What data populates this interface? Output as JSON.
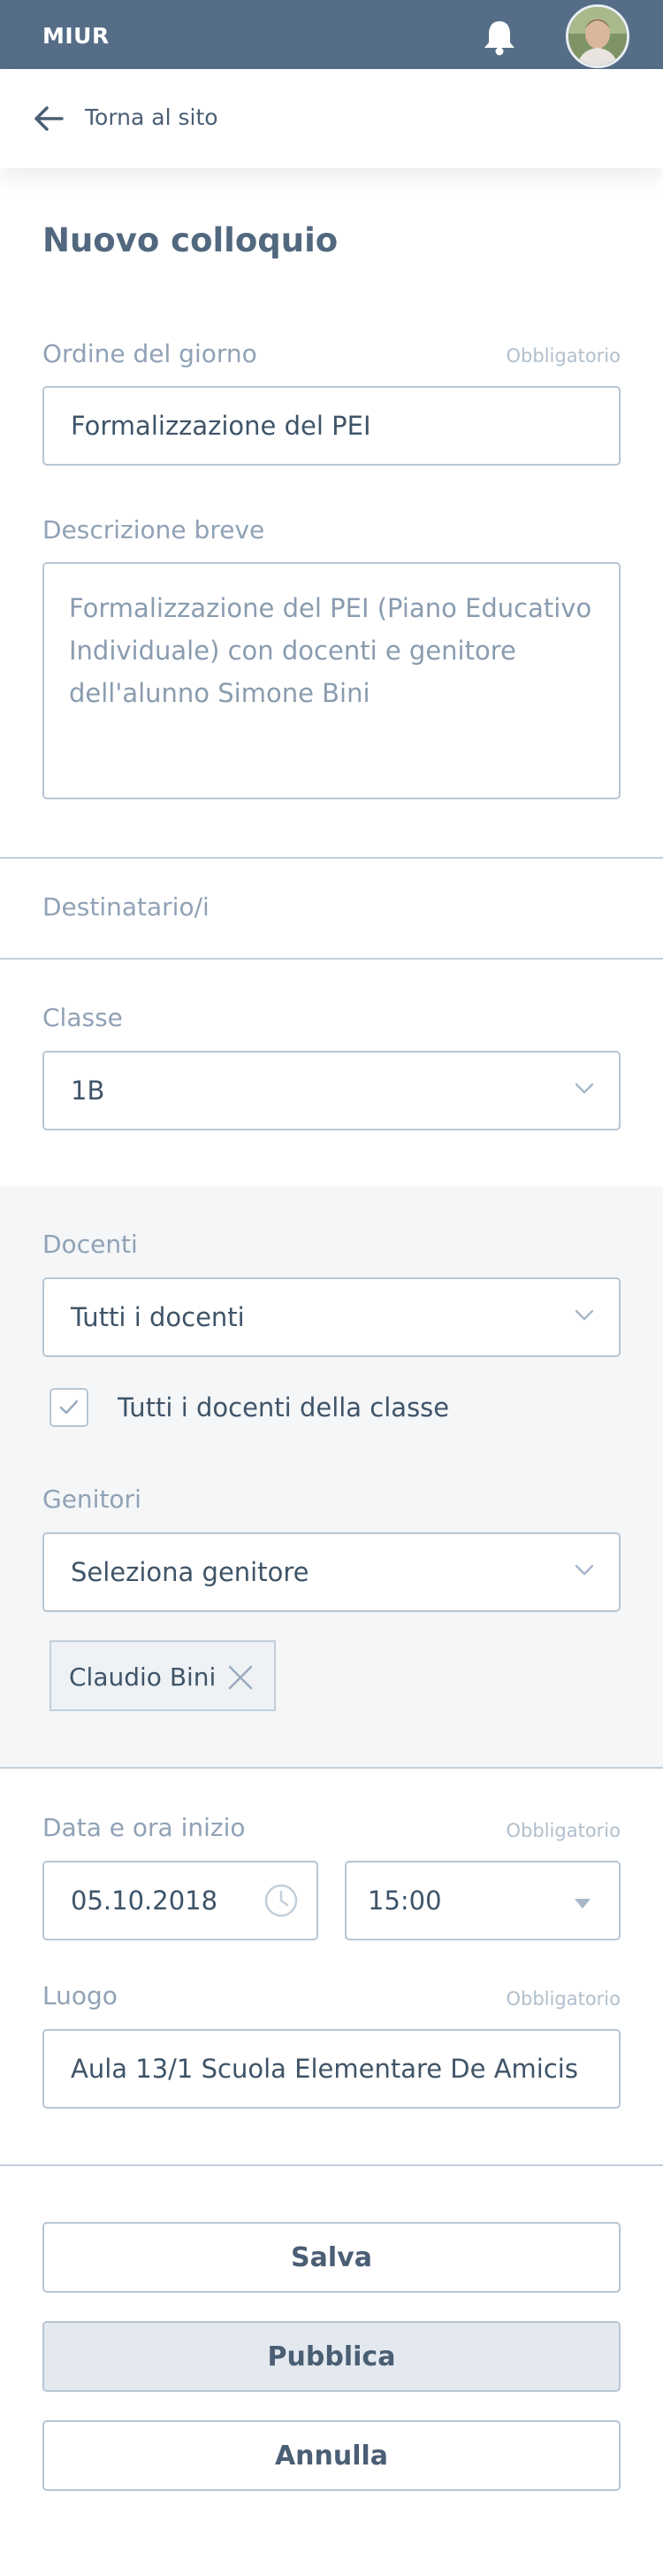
{
  "header": {
    "brand": "MIUR",
    "notification_icon": "bell-icon",
    "avatar_icon": "user-avatar",
    "color": "#556d87"
  },
  "back": {
    "label": "Torna al sito",
    "icon": "arrow-left-icon"
  },
  "page_title": "Nuovo colloquio",
  "form": {
    "agenda": {
      "label": "Ordine del giorno",
      "required": "Obbligatorio",
      "value": "Formalizzazione del PEI"
    },
    "description": {
      "label": "Descrizione breve",
      "value": "Formalizzazione del PEI (Piano Educativo Individuale) con docenti e genitore dell'alunno Simone Bini"
    },
    "recipients": {
      "label": "Destinatario/i"
    },
    "class": {
      "label": "Classe",
      "value": "1B"
    },
    "teachers": {
      "label": "Docenti",
      "value": "Tutti i docenti",
      "checkbox_label": "Tutti i docenti della classe",
      "checkbox_checked": true
    },
    "parents": {
      "label": "Genitori",
      "placeholder": "Seleziona genitore",
      "selected_tags": [
        "Claudio Bini"
      ]
    },
    "start": {
      "label": "Data e ora inizio",
      "required": "Obbligatorio",
      "date": "05.10.2018",
      "time": "15:00"
    },
    "place": {
      "label": "Luogo",
      "required": "Obbligatorio",
      "value": "Aula 13/1 Scuola Elementare De Amicis"
    }
  },
  "actions": {
    "save": "Salva",
    "publish": "Pubblica",
    "cancel": "Annulla"
  }
}
